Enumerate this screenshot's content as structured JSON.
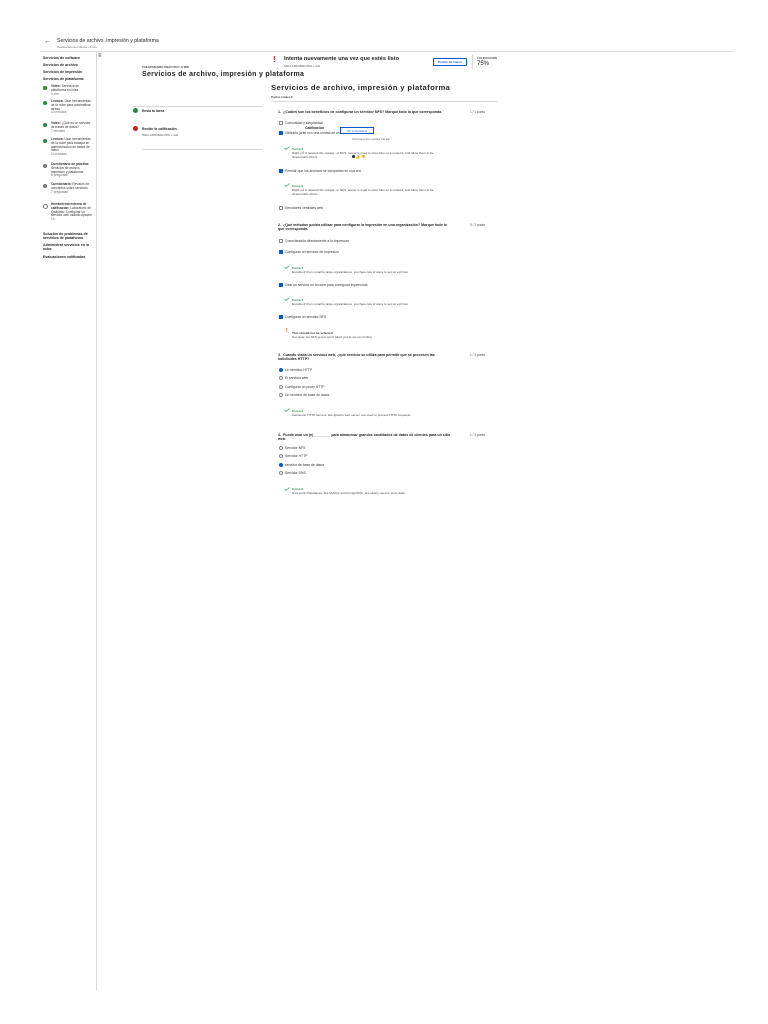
{
  "header": {
    "title": "Servicios de archivo, impresión y plataforma",
    "subtitle": "Cuestionario de práctica • 8 min"
  },
  "sidebar": {
    "items_top": [
      "Servicios de software",
      "Servicios de archivo",
      "Servicios de impresión",
      "Servicios de plataforma"
    ],
    "lessons": [
      {
        "status": "done",
        "title": "Video:",
        "rest": " Servicios de plataforma en línea",
        "meta": "4 min"
      },
      {
        "status": "done",
        "title": "Lectura:",
        "rest": " Usar herramientas de la nube para automatizar tareas",
        "meta": "10 minutos"
      },
      {
        "status": "done",
        "title": "Video:",
        "rest": " ¿Qué es un servidor de bases de datos?",
        "meta": "7 minutos"
      },
      {
        "status": "done",
        "title": "Lectura:",
        "rest": " Usar herramientas de la nube para trabajar en administración de bases de datos",
        "meta": "10 minutos"
      },
      {
        "status": "pending",
        "title": "Cuestionario de práctica:",
        "rest": " Servicios de archivo, impresión y plataforma",
        "meta": "8 preguntas"
      },
      {
        "status": "pending",
        "title": "Cuestionario:",
        "rest": " Revisión de conceptos sobre servicios",
        "meta": "7 preguntas"
      },
      {
        "status": "open",
        "title": "Herramienta externa de calificación:",
        "rest": " Laboratorio de Qwiklabs: Configurar un servidor web usando Apache",
        "meta": "1h"
      }
    ],
    "items_bottom": [
      "Solución de problemas de servicios de plataforma",
      "Administrar servicios en la nube",
      "Evaluaciones calificadas"
    ]
  },
  "left_panel": {
    "kicker": "CUESTIONARIO PRÁCTICO • 8 MIN",
    "title": "Servicios de archivo, impresión y plataforma",
    "submit_label": "Envía tu tarea",
    "grade_label": "Recibir la calificación",
    "grade_sub": "PARA APROBAR 80% o más"
  },
  "banner": {
    "title": "Intenta nuevamente una vez que estés listo",
    "sub": "PARA APROBAR 80% o más",
    "retry_label": "Probar de nuevo",
    "score_label": "CALIFICACIÓN",
    "score": "75%"
  },
  "popover": {
    "label": "Calificación",
    "button": "Ver comentarios",
    "note": "Conservaremos tu puntaje más alto"
  },
  "quiz": {
    "title": "Servicios de archivo, impresión y plataforma",
    "total": "Puntos totales 8",
    "questions": [
      {
        "num": "1.",
        "text": "¿Cuáles son los beneficios de configurar un servidor NFS? Marque todo lo que corresponda.",
        "points": "1 / 1 punto",
        "options": [
          {
            "text": "Comodidad y simplicidad",
            "on": false
          },
          {
            "text": "Utilizarlo junto con una unidad de red",
            "on": true
          },
          {
            "text": "Permitir que los archivos se compartan en una red",
            "on": true
          },
          {
            "text": "Servidores centrales web",
            "on": false
          }
        ],
        "feedback": [
          {
            "type": "ok",
            "title": "Correct",
            "desc": "Right on! A network file storage, or NFS, server is used to store files on a network, and allow them to be shared with others."
          },
          {
            "type": "ok",
            "title": "Correct",
            "desc": "Right on! A network file storage, or NFS, server is used to store files on a network, and allow them to be shared with others."
          }
        ]
      },
      {
        "num": "2.",
        "text": "¿Qué métodos podría utilizar para configurar la impresión en una organización? Marque todo lo que corresponda.",
        "points": "0 / 1 punto",
        "options": [
          {
            "text": "Conectándola directamente a la impresora",
            "on": false
          },
          {
            "text": "Configurar un servidor de impresión",
            "on": true
          },
          {
            "text": "Usar un servicio en la nube para configurar impresoras",
            "on": true
          },
          {
            "text": "Configurar un servidor NFS",
            "on": true
          }
        ],
        "feedback": [
          {
            "type": "ok",
            "title": "Correct",
            "desc": "Excellent! From small to large organizations, you have lots of ways to set up a printer."
          },
          {
            "type": "ok",
            "title": "Correct",
            "desc": "Excellent! From small to large organizations, you have lots of ways to set up a printer."
          },
          {
            "type": "bad",
            "title": "This should not be selected",
            "desc": "Not quite. An NFS server won't allow you to set up printing."
          }
        ]
      },
      {
        "num": "3.",
        "text": "Cuando visita un servidor web, ¿qué servicio se utiliza para permitir que se procesen las solicitudes HTTP?",
        "points": "1 / 1 punto",
        "options": [
          {
            "text": "Un servidor HTTP",
            "on": true
          },
          {
            "text": "El servidor web",
            "on": false
          },
          {
            "text": "Configurar un proxy HTTP",
            "on": false
          },
          {
            "text": "Un servidor de base de datos",
            "on": false
          }
        ],
        "feedback": [
          {
            "type": "ok",
            "title": "Correct",
            "desc": "Awesome! HTTP servers, like Apache web server, are used to process HTTP requests."
          }
        ]
      },
      {
        "num": "4.",
        "text": "Puede usar un (n) ________ para almacenar grandes cantidades de datos de clientes para un sitio web.",
        "points": "1 / 1 punto",
        "options": [
          {
            "text": "Servidor NFS",
            "on": false
          },
          {
            "text": "Servidor HTTP",
            "on": false
          },
          {
            "text": "servidor de base de datos",
            "on": true
          },
          {
            "text": "Servidor DNS",
            "on": false
          }
        ],
        "feedback": [
          {
            "type": "ok",
            "title": "Correct",
            "desc": "Nice work! Databases, like MySQL and PostgreSQL, are widely used to store data."
          }
        ]
      }
    ]
  }
}
